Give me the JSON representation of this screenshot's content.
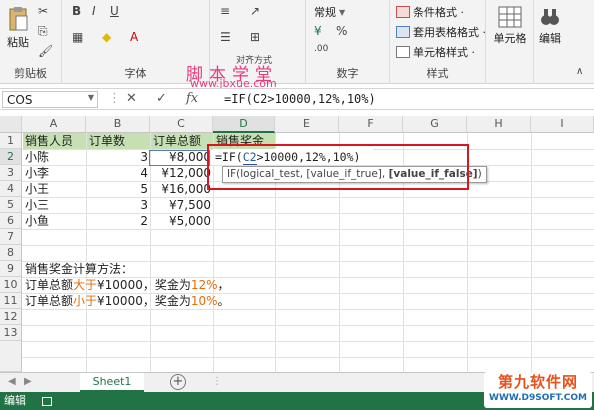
{
  "ribbon": {
    "clipboard": {
      "paste": "粘贴",
      "label": "剪贴板"
    },
    "font": {
      "label": "字体"
    },
    "alignment": {
      "partial": "对齐方式"
    },
    "number": {
      "format": "常规",
      "label": "数字"
    },
    "styles": {
      "items": [
        "条件格式 ·",
        "套用表格格式 ·",
        "单元格样式 ·"
      ],
      "label": "样式"
    },
    "cells": {
      "label": "单元格"
    },
    "editing": {
      "label": "编辑"
    }
  },
  "watermark": {
    "line1": "脚本学堂",
    "line2": "www.jbxue.com"
  },
  "formula_bar": {
    "name_box": "COS",
    "cancel": "✕",
    "enter": "✓",
    "fx": "fx",
    "formula": "=IF(C2>10000,12%,10%)"
  },
  "columns": [
    "A",
    "B",
    "C",
    "D",
    "E",
    "F",
    "G",
    "H",
    "I"
  ],
  "rows": [
    "1",
    "2",
    "3",
    "4",
    "5",
    "6",
    "7",
    "8",
    "9",
    "10",
    "11",
    "12",
    "13"
  ],
  "table": {
    "headers": [
      "销售人员",
      "订单数",
      "订单总额",
      "销售奖金"
    ],
    "data": [
      {
        "name": "小陈",
        "orders": "3",
        "total": "¥8,000"
      },
      {
        "name": "小李",
        "orders": "4",
        "total": "¥12,000"
      },
      {
        "name": "小王",
        "orders": "5",
        "total": "¥16,000"
      },
      {
        "name": "小三",
        "orders": "3",
        "total": "¥7,500"
      },
      {
        "name": "小鱼",
        "orders": "2",
        "total": "¥5,000"
      }
    ]
  },
  "editing_cell": {
    "prefix": "=IF(",
    "ref": "C2",
    "suffix": ">10000,12%,10%)"
  },
  "tooltip": {
    "func": "IF(logical_test, [value_if_true], ",
    "active": "[value_if_false]",
    "close": ")"
  },
  "notes": {
    "title": "销售奖金计算方法：",
    "line1_a": "订单总额",
    "line1_cmp": "大于",
    "line1_b": "¥10000，奖金为",
    "line1_pct": "12%",
    "line1_end": "，",
    "line2_a": "订单总额",
    "line2_cmp": "小于",
    "line2_b": "¥10000，奖金为",
    "line2_pct": "10%",
    "line2_end": "。"
  },
  "sheet_tab": "Sheet1",
  "status": "编辑",
  "logo": {
    "line1": "第九软件网",
    "line2": "WWW.D9SOFT.COM"
  },
  "colors": {
    "excel_green": "#217346",
    "header_green": "#c6e0b4",
    "red_box": "#d6171f"
  }
}
